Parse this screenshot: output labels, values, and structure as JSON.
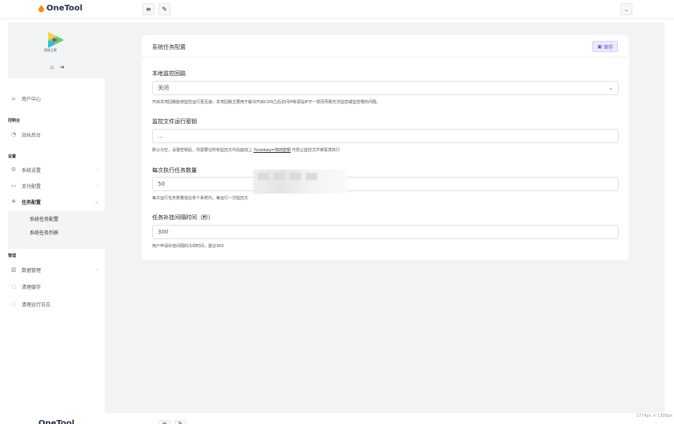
{
  "app": {
    "brand": "OneTool",
    "dimensions_label": "1774px × 1305px"
  },
  "topbar": {
    "menu_icon": "≡",
    "brush_icon": "✎",
    "dropdown_icon": "⌄"
  },
  "sidebar": {
    "logo_caption": "奇迹之家",
    "items": [
      {
        "label": "用户中心",
        "icon": "user-icon"
      },
      {
        "label": "站长后台",
        "icon": "dashboard-icon"
      },
      {
        "label": "系统设置",
        "icon": "gear-icon"
      },
      {
        "label": "支付配置",
        "icon": "card-icon"
      },
      {
        "label": "任务配置",
        "icon": "task-icon"
      },
      {
        "label": "数据管理",
        "icon": "chart-icon"
      },
      {
        "label": "清理缓存",
        "icon": "refresh-icon"
      },
      {
        "label": "清理运行日志",
        "icon": "refresh-icon"
      }
    ],
    "sections": {
      "console": "控制台",
      "settings": "设置",
      "manage": "管理"
    },
    "sub_items": [
      "系统任务配置",
      "系统任务列表"
    ]
  },
  "card": {
    "title": "系统任务配置",
    "save_label": "保存",
    "fields": [
      {
        "label": "本地监控回路",
        "value": "关闭",
        "help": "开启本地回路能使监控运行更迅速。本地回路主要用于解决开启CDN之后访问IP和源站IP不一样而导致无法监控或监控慢的问题。"
      },
      {
        "label": "监控文件运行密钥",
        "value": "...",
        "help_prefix": "默认为空，设置密钥后，你需要在所有监控文件后面加上 ",
        "help_link": "?cronkey=你的密钥",
        "help_suffix": " 可防止监控文件被恶意执行"
      },
      {
        "label": "每次执行任务数量",
        "value": "50",
        "help": "每次运行任务数量指在单个系统内，每运行一次监控文"
      },
      {
        "label": "任务补挂间隔时间（秒）",
        "value": "300",
        "help": "用户申请补挂间隔的冷却时间，建议300"
      }
    ]
  },
  "colors": {
    "accent": "#6b48d6",
    "main_bg": "#f2f3f5"
  }
}
